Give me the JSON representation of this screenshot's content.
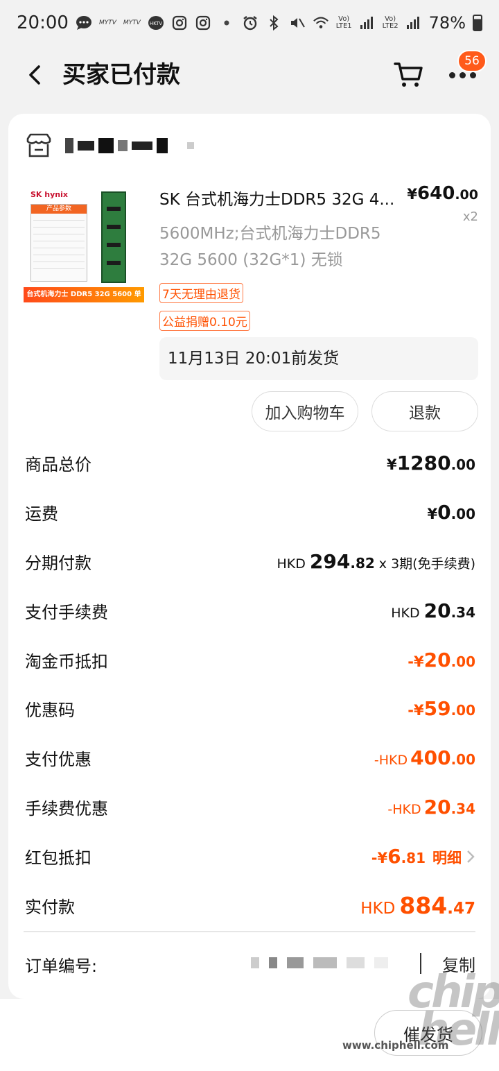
{
  "status_bar": {
    "time": "20:00",
    "app_icons": [
      "message-icon",
      "mytv-icon",
      "mytv-icon",
      "hktv-icon",
      "instagram-icon",
      "instagram-icon"
    ],
    "mytv_label": "MYTV",
    "hktv_label": "HKTV",
    "lte1": "LTE1",
    "lte2": "LTE2",
    "volte": "Vo)",
    "battery": "78%"
  },
  "header": {
    "title": "买家已付款",
    "badge_count": "56"
  },
  "product": {
    "image_logo": "SK hynix",
    "image_table_title": "产品参数",
    "image_banner": "台式机海力士 DDR5 32G 5600 单条",
    "title": "SK 台式机海力士DDR5 32G 4...",
    "price_symbol": "¥",
    "price_int": "640",
    "price_dec": ".00",
    "quantity": "x2",
    "spec": "5600MHz;台式机海力士DDR5 32G 5600 (32G*1) 无锁",
    "tags": [
      "7天无理由退货",
      "公益捐赠0.10元"
    ],
    "ship_note": "11月13日 20:01前发货",
    "buttons": {
      "add_cart": "加入购物车",
      "refund": "退款"
    }
  },
  "summary": {
    "goods_total": {
      "label": "商品总价",
      "sym": "¥",
      "int": "1280",
      "dec": ".00"
    },
    "shipping": {
      "label": "运费",
      "sym": "¥",
      "int": "0",
      "dec": ".00"
    },
    "installment": {
      "label": "分期付款",
      "prefix": "HKD",
      "int": "294",
      "dec": ".82",
      "suffix": "x 3期(免手续费)"
    },
    "pay_fee": {
      "label": "支付手续费",
      "prefix": "HKD",
      "int": "20",
      "dec": ".34"
    },
    "taojinbi": {
      "label": "淘金币抵扣",
      "sym": "-¥",
      "int": "20",
      "dec": ".00"
    },
    "coupon": {
      "label": "优惠码",
      "sym": "-¥",
      "int": "59",
      "dec": ".00"
    },
    "pay_discount": {
      "label": "支付优惠",
      "prefix": "-HKD",
      "int": "400",
      "dec": ".00"
    },
    "fee_discount": {
      "label": "手续费优惠",
      "prefix": "-HKD",
      "int": "20",
      "dec": ".34"
    },
    "red_packet": {
      "label": "红包抵扣",
      "sym": "-¥",
      "int": "6",
      "dec": ".81",
      "detail": "明细"
    },
    "actual_paid": {
      "label": "实付款",
      "prefix": "HKD",
      "int": "884",
      "dec": ".47"
    }
  },
  "order": {
    "label": "订单编号:",
    "copy": "复制"
  },
  "bottom": {
    "urge_button": "催发货"
  },
  "watermark": {
    "text": "chip hell",
    "url": "www.chiphell.com"
  },
  "colors": {
    "accent": "#ff5000",
    "badge": "#ff5a1a",
    "background": "#f2f2f2"
  }
}
